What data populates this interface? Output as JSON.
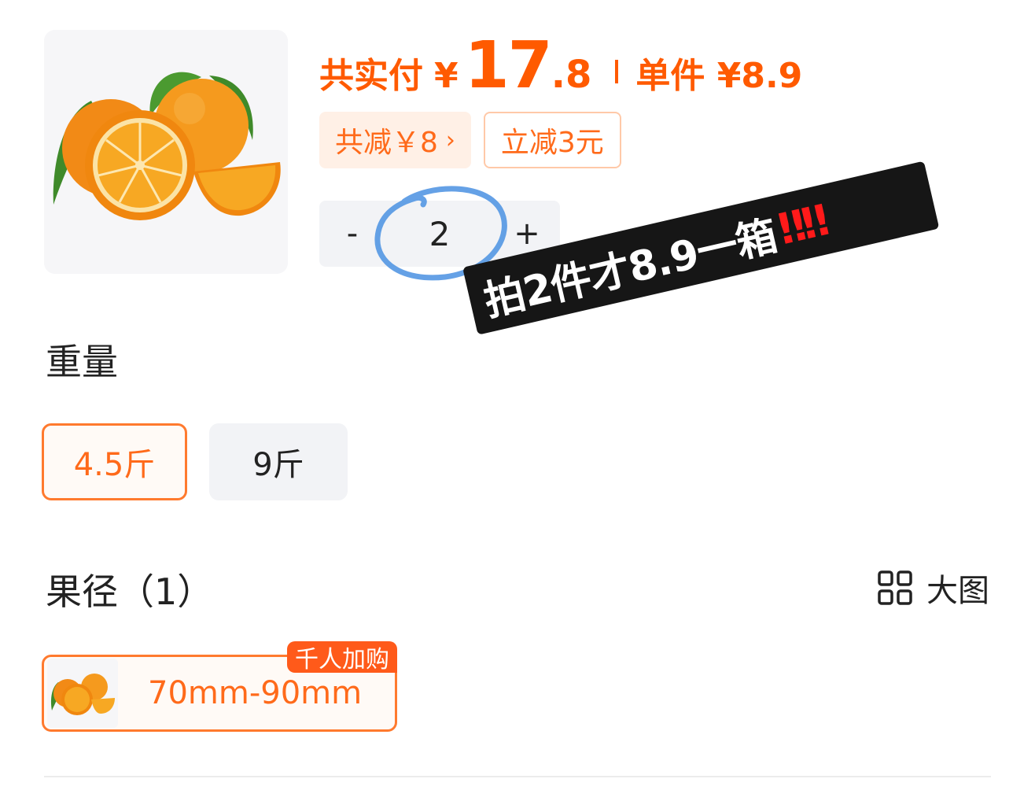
{
  "product": {
    "image_icon": "orange-fruit-image"
  },
  "price": {
    "label": "共实付",
    "currency": "¥",
    "total_integer": "17",
    "total_decimal": ".8",
    "unit_price": "单件 ¥8.9",
    "color": "#ff5a00"
  },
  "tags": {
    "discount": "共减￥8",
    "discount_chevron": "›",
    "instant": "立减3元"
  },
  "stepper": {
    "minus": "-",
    "quantity": "2",
    "plus": "+"
  },
  "annotation": {
    "banner_text": "拍2件才8.9一箱",
    "banner_excl": "‼‼"
  },
  "weight": {
    "title": "重量",
    "options": [
      "4.5斤",
      "9斤"
    ],
    "selected": "4.5斤"
  },
  "size": {
    "title": "果径（1）",
    "big_view_label": "大图",
    "big_view_icon": "grid-icon",
    "option_label": "70mm-90mm",
    "badge": "千人加购"
  },
  "colors": {
    "accent": "#ff6a1a",
    "tag_bg": "#fff0e6",
    "option_bg": "#f2f3f6",
    "annotation_circle": "#4a90e2",
    "banner_bg": "#161616",
    "banner_excl": "#ff1a1a"
  }
}
